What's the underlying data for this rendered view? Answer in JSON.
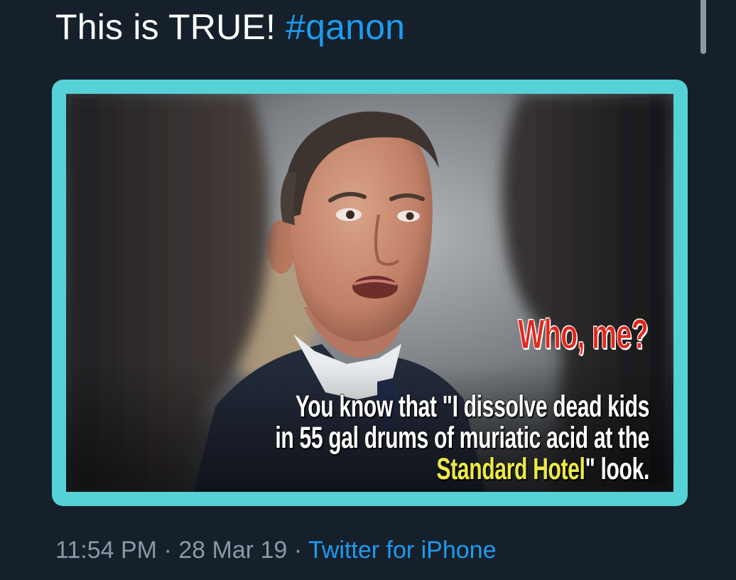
{
  "tweet": {
    "text": "This is TRUE!",
    "hashtag": "#qanon"
  },
  "media": {
    "caption_red": "Who, me?",
    "caption_line1": "You know that \"I dissolve dead kids",
    "caption_line2": "in 55 gal drums of muriatic acid at the",
    "caption_highlight": "Standard Hotel",
    "caption_end": "\" look."
  },
  "meta": {
    "time": "11:54 PM",
    "separator": " · ",
    "date": "28 Mar 19",
    "source": "Twitter for iPhone"
  },
  "colors": {
    "background": "#15202b",
    "accent": "#1d9bf0",
    "frame": "#56d2d6",
    "caption_red": "#e3261b",
    "caption_yellow": "#ecea48",
    "meta_gray": "#8899a6"
  }
}
